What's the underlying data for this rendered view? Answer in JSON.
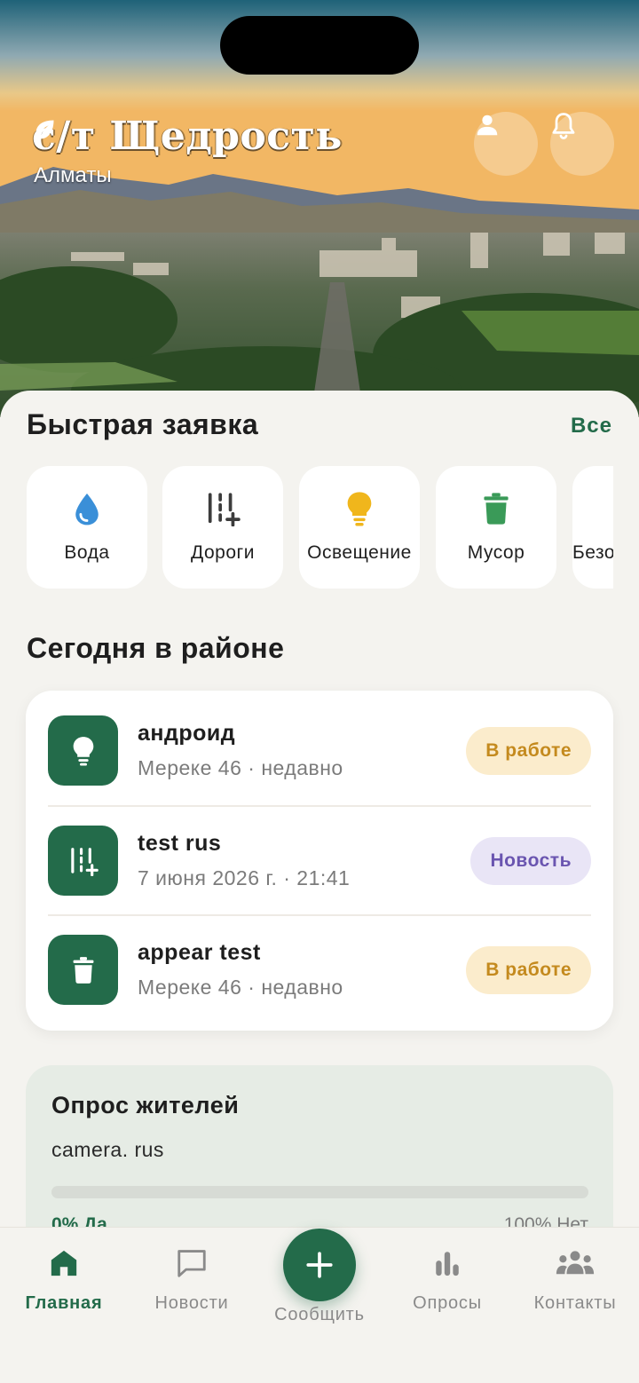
{
  "header": {
    "brand": "с/т Щедрость",
    "city": "Алматы"
  },
  "quick_request": {
    "title": "Быстрая заявка",
    "all_link": "Все",
    "items": [
      {
        "label": "Вода",
        "icon": "water-drop-icon",
        "color": "#3a8fd8"
      },
      {
        "label": "Дороги",
        "icon": "road-icon",
        "color": "#3c3c3c"
      },
      {
        "label": "Освещение",
        "icon": "lightbulb-icon",
        "color": "#f0b61c"
      },
      {
        "label": "Мусор",
        "icon": "trash-icon",
        "color": "#3a9a58"
      },
      {
        "label": "Безо",
        "icon": "shield-icon",
        "color": "#3c3c3c"
      }
    ]
  },
  "today": {
    "title": "Сегодня в районе",
    "items": [
      {
        "title": "андроид",
        "subtitle": "Мереке 46 · недавно",
        "status": "В работе",
        "icon": "lightbulb-icon"
      },
      {
        "title": "test rus",
        "subtitle": "7 июня 2026 г. · 21:41",
        "status": "Новость",
        "icon": "road-icon"
      },
      {
        "title": "appear test",
        "subtitle": "Мереке 46 · недавно",
        "status": "В работе",
        "icon": "trash-icon"
      }
    ]
  },
  "poll": {
    "title": "Опрос жителей",
    "question": "camera. rus",
    "yes_label": "0% Да",
    "no_label": "100% Нет",
    "yes_percent": 0
  },
  "tabbar": {
    "home": "Главная",
    "news": "Новости",
    "report": "Сообщить",
    "polls": "Опросы",
    "contacts": "Контакты"
  },
  "colors": {
    "accent": "#236b4a",
    "status_work_bg": "#fbeccc",
    "status_work_text": "#c48a1e",
    "status_news_bg": "#e9e5f6",
    "status_news_text": "#6a55b0"
  }
}
